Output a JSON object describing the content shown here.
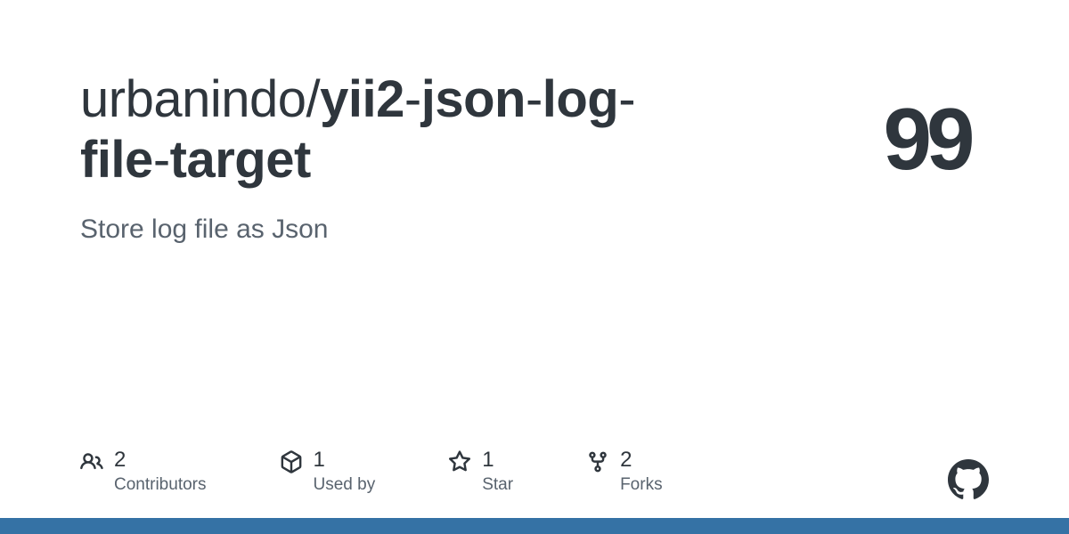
{
  "repo": {
    "owner": "urbanindo",
    "name_parts": [
      "yii2",
      "json",
      "log",
      "file",
      "target"
    ],
    "description": "Store log file as Json"
  },
  "avatar_text": "99",
  "stats": {
    "contributors": {
      "count": "2",
      "label": "Contributors"
    },
    "used_by": {
      "count": "1",
      "label": "Used by"
    },
    "star": {
      "count": "1",
      "label": "Star"
    },
    "forks": {
      "count": "2",
      "label": "Forks"
    }
  },
  "language_bar": [
    {
      "color": "#3572A5",
      "percent": 100
    }
  ]
}
